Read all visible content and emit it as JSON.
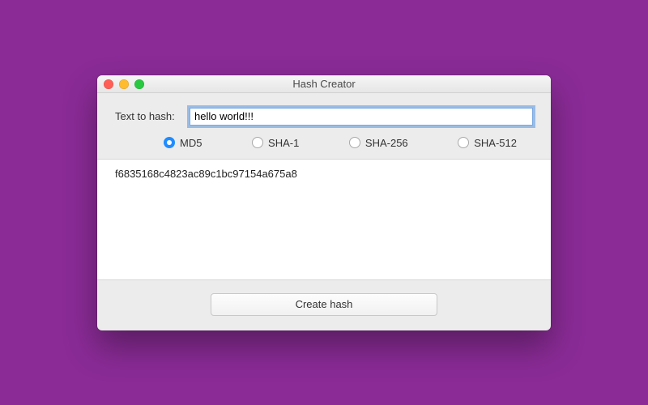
{
  "window": {
    "title": "Hash Creator"
  },
  "form": {
    "label": "Text to hash:",
    "input_value": "hello world!!!"
  },
  "algorithms": [
    {
      "key": "md5",
      "label": "MD5",
      "selected": true
    },
    {
      "key": "sha1",
      "label": "SHA-1",
      "selected": false
    },
    {
      "key": "sha256",
      "label": "SHA-256",
      "selected": false
    },
    {
      "key": "sha512",
      "label": "SHA-512",
      "selected": false
    }
  ],
  "result": {
    "hash": "f6835168c4823ac89c1bc97154a675a8"
  },
  "actions": {
    "create_label": "Create hash"
  }
}
